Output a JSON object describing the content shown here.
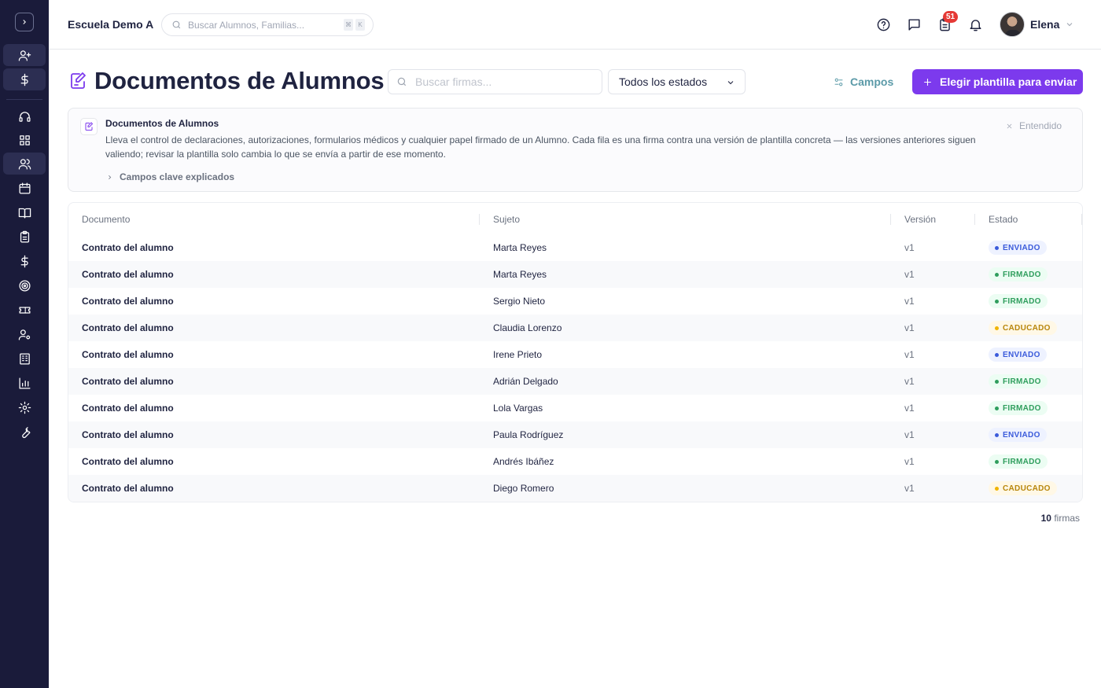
{
  "topbar": {
    "school_name": "Escuela Demo A",
    "search_placeholder": "Buscar Alumnos, Familias...",
    "shortcut_keys": [
      "⌘",
      "K"
    ],
    "notification_badge": "51",
    "user_name": "Elena"
  },
  "header": {
    "title": "Documentos de Alumnos",
    "search_placeholder": "Buscar firmas...",
    "status_filter": "Todos los estados",
    "fields_button": "Campos",
    "primary_button": "Elegir plantilla para enviar"
  },
  "info": {
    "title": "Documentos de Alumnos",
    "text": "Lleva el control de declaraciones, autorizaciones, formularios médicos y cualquier papel firmado de un Alumno. Cada fila es una firma contra una versión de plantilla concreta — las versiones anteriores siguen valiendo; revisar la plantilla solo cambia lo que se envía a partir de ese momento.",
    "toggle": "Campos clave explicados",
    "dismiss": "Entendido"
  },
  "table": {
    "columns": [
      "Documento",
      "Sujeto",
      "Versión",
      "Estado"
    ],
    "rows": [
      {
        "document": "Contrato del alumno",
        "subject": "Marta Reyes",
        "version": "v1",
        "status": "ENVIADO"
      },
      {
        "document": "Contrato del alumno",
        "subject": "Marta Reyes",
        "version": "v1",
        "status": "FIRMADO"
      },
      {
        "document": "Contrato del alumno",
        "subject": "Sergio Nieto",
        "version": "v1",
        "status": "FIRMADO"
      },
      {
        "document": "Contrato del alumno",
        "subject": "Claudia Lorenzo",
        "version": "v1",
        "status": "CADUCADO"
      },
      {
        "document": "Contrato del alumno",
        "subject": "Irene Prieto",
        "version": "v1",
        "status": "ENVIADO"
      },
      {
        "document": "Contrato del alumno",
        "subject": "Adrián Delgado",
        "version": "v1",
        "status": "FIRMADO"
      },
      {
        "document": "Contrato del alumno",
        "subject": "Lola Vargas",
        "version": "v1",
        "status": "FIRMADO"
      },
      {
        "document": "Contrato del alumno",
        "subject": "Paula Rodríguez",
        "version": "v1",
        "status": "ENVIADO"
      },
      {
        "document": "Contrato del alumno",
        "subject": "Andrés Ibáñez",
        "version": "v1",
        "status": "FIRMADO"
      },
      {
        "document": "Contrato del alumno",
        "subject": "Diego Romero",
        "version": "v1",
        "status": "CADUCADO"
      }
    ]
  },
  "footer": {
    "count": "10",
    "count_label": "firmas"
  },
  "sidebar": {
    "icons": [
      "expand-icon",
      "user-plus-icon",
      "dollar-icon",
      "headset-icon",
      "dashboard-icon",
      "users-icon",
      "calendar-icon",
      "book-icon",
      "clipboard-icon",
      "dollar-icon",
      "target-icon",
      "ticket-icon",
      "user-cog-icon",
      "building-icon",
      "bar-chart-icon",
      "settings-icon",
      "wrench-icon"
    ],
    "active": "users-icon"
  },
  "colors": {
    "sidebar_bg": "#1a1b3a",
    "accent": "#7c3aed",
    "sent": "#3b5bdb",
    "signed": "#2f9e5d",
    "expired": "#f0b400"
  }
}
